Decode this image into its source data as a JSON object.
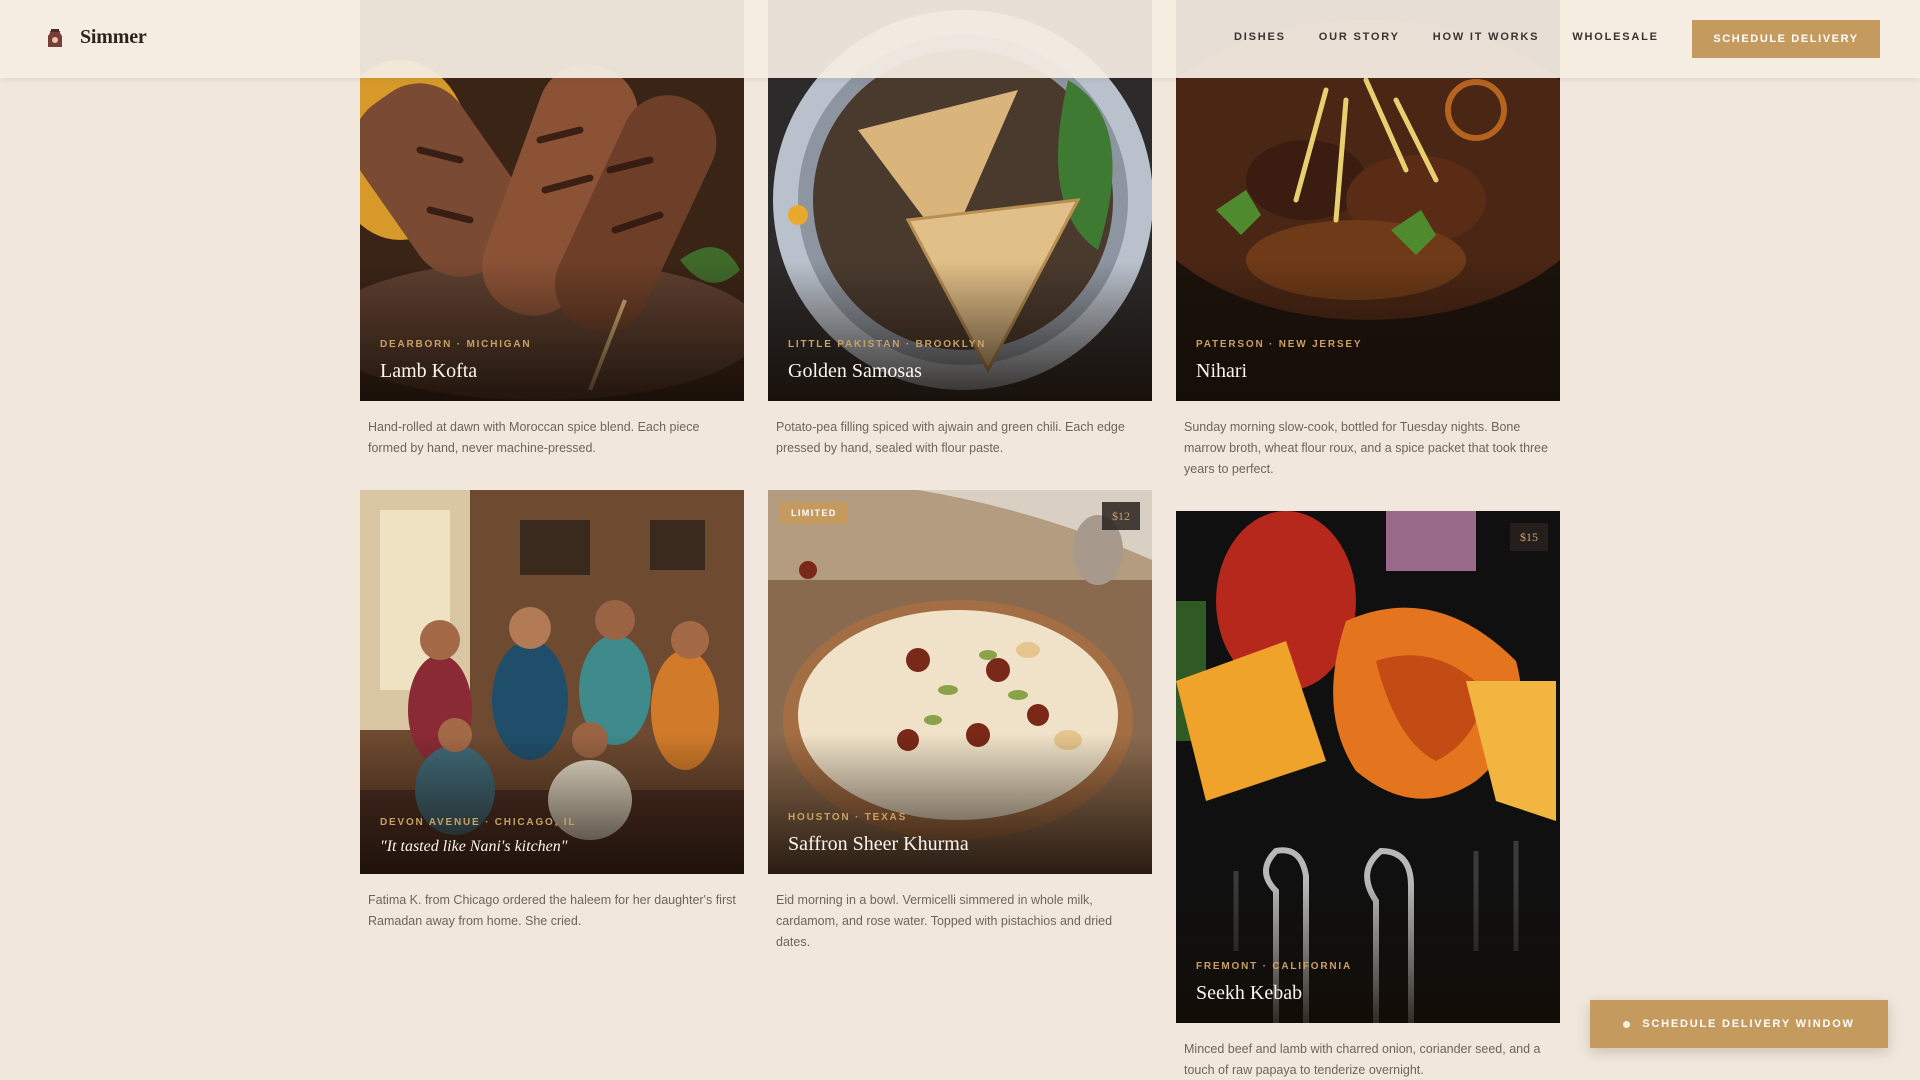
{
  "header": {
    "brand": "Simmer",
    "nav": [
      "DISHES",
      "OUR STORY",
      "HOW IT WORKS",
      "WHOLESALE"
    ],
    "cta": "SCHEDULE DELIVERY"
  },
  "cards": [
    {
      "location": "DEARBORN · MICHIGAN",
      "title": "Lamb Kofta",
      "description": "Hand-rolled at dawn with Moroccan spice blend. Each piece formed by hand, never machine-pressed."
    },
    {
      "location": "LITTLE PAKISTAN · BROOKLYN",
      "title": "Golden Samosas",
      "description": "Potato-pea filling spiced with ajwain and green chili. Each edge pressed by hand, sealed with flour paste."
    },
    {
      "location": "PATERSON · NEW JERSEY",
      "title": "Nihari",
      "description": "Sunday morning slow-cook, bottled for Tuesday nights. Bone marrow broth, wheat flour roux, and a spice packet that took three years to perfect."
    },
    {
      "location": "DEVON AVENUE · CHICAGO, IL",
      "title": "\"It tasted like Nani's kitchen\"",
      "description": "Fatima K. from Chicago ordered the haleem for her daughter's first Ramadan away from home. She cried."
    },
    {
      "location": "HOUSTON · TEXAS",
      "title": "Saffron Sheer Khurma",
      "description": "Eid morning in a bowl. Vermicelli simmered in whole milk, cardamom, and rose water. Topped with pistachios and dried dates.",
      "badge": "LIMITED",
      "price": "$12"
    },
    {
      "location": "FREMONT · CALIFORNIA",
      "title": "Seekh Kebab",
      "description": "Minced beef and lamb with charred onion, coriander seed, and a touch of raw papaya to tenderize overnight.",
      "price": "$15"
    }
  ],
  "floating_button": "SCHEDULE DELIVERY WINDOW",
  "colors": {
    "accent": "#c49a5e",
    "background": "#f1e7dc",
    "location_text": "#c9a063"
  }
}
